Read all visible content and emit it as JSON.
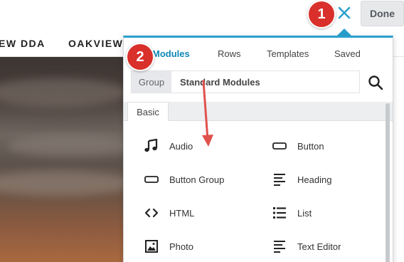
{
  "topbar": {
    "done_label": "Done"
  },
  "site_nav": {
    "items": [
      "EW DDA",
      "OAKVIEW"
    ]
  },
  "panel": {
    "tabs": [
      {
        "label": "Modules",
        "active": true
      },
      {
        "label": "Rows"
      },
      {
        "label": "Templates"
      },
      {
        "label": "Saved"
      }
    ],
    "group_label": "Group",
    "group_value": "Standard Modules",
    "section_label": "Basic",
    "modules": [
      {
        "label": "Audio",
        "icon": "music-note-icon"
      },
      {
        "label": "Button",
        "icon": "button-icon"
      },
      {
        "label": "Button Group",
        "icon": "button-group-icon"
      },
      {
        "label": "Heading",
        "icon": "heading-icon"
      },
      {
        "label": "HTML",
        "icon": "code-icon"
      },
      {
        "label": "List",
        "icon": "list-icon"
      },
      {
        "label": "Photo",
        "icon": "photo-icon"
      },
      {
        "label": "Text Editor",
        "icon": "text-editor-icon"
      }
    ]
  },
  "annotations": {
    "badge1": "1",
    "badge2": "2"
  },
  "colors": {
    "accent": "#2aa0cf",
    "badge": "#d9302b",
    "arrow": "#e0524c"
  }
}
